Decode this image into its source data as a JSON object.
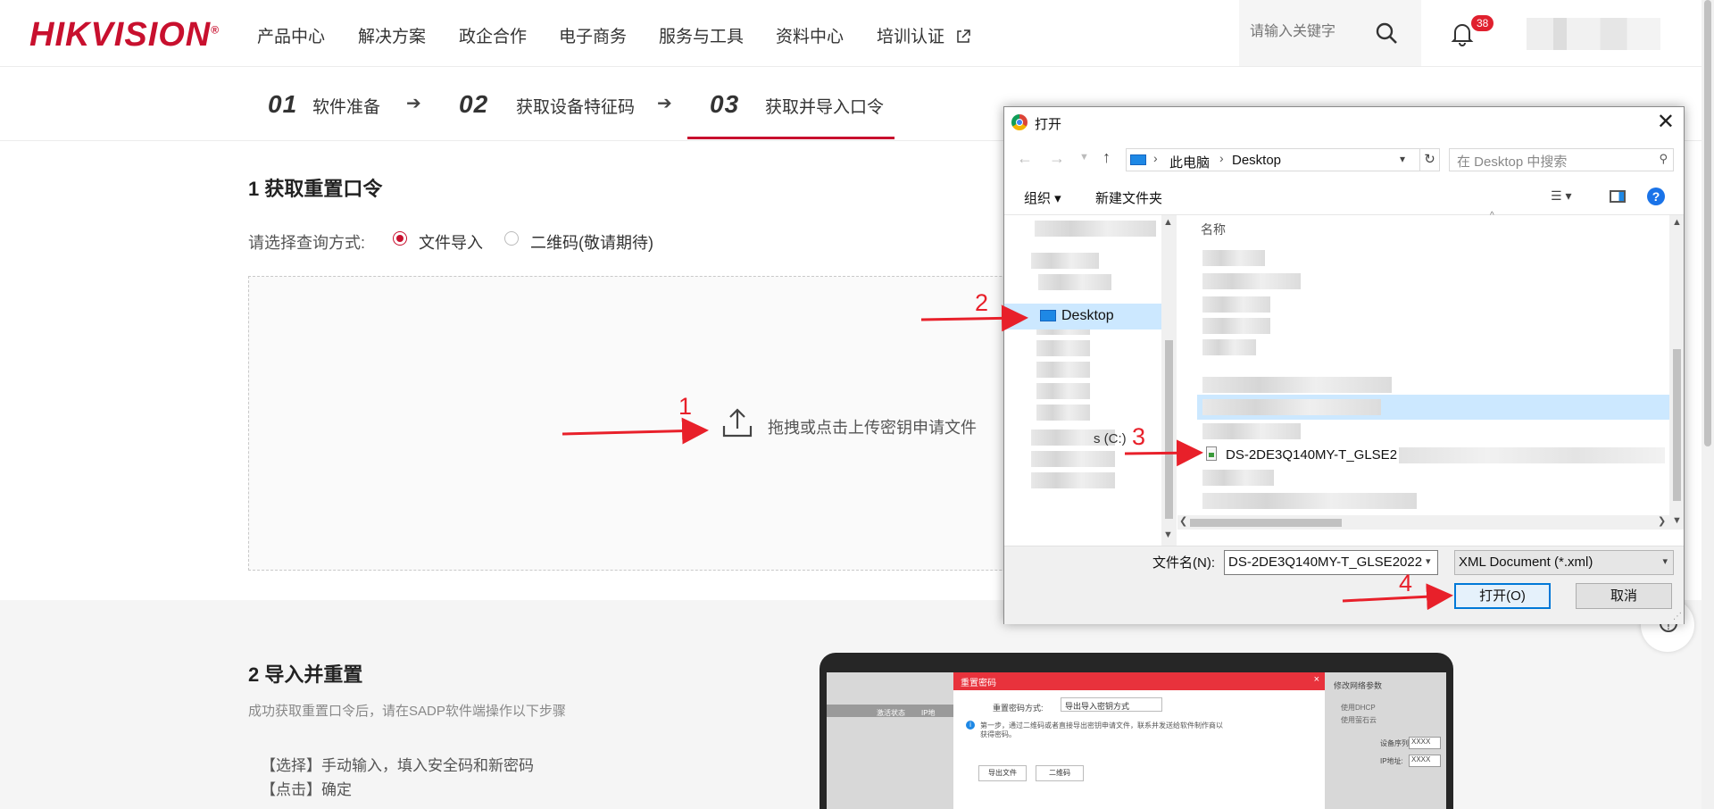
{
  "header": {
    "logo": "HIKVISION",
    "logo_mark": "®",
    "nav": [
      "产品中心",
      "解决方案",
      "政企合作",
      "电子商务",
      "服务与工具",
      "资料中心",
      "培训认证"
    ],
    "search_placeholder": "请输入关键字",
    "notification_count": "38"
  },
  "steps": [
    {
      "num": "01",
      "label": "软件准备"
    },
    {
      "num": "02",
      "label": "获取设备特征码"
    },
    {
      "num": "03",
      "label": "获取并导入口令"
    }
  ],
  "section1": {
    "title": "1 获取重置口令",
    "query_label": "请选择查询方式:",
    "options": [
      "文件导入",
      "二维码(敬请期待)"
    ],
    "selected_option": "文件导入",
    "dropzone_text": "拖拽或点击上传密钥申请文件"
  },
  "section2": {
    "title": "2 导入并重置",
    "subtitle": "成功获取重置口令后，请在SADP软件端操作以下步骤",
    "steps": [
      "【选择】手动输入，填入安全码和新密码",
      "【点击】确定"
    ],
    "preview": {
      "dialog_title": "重置密码",
      "method_label": "重置密码方式:",
      "method_value": "导出导入密钥方式",
      "desc_line1": "第一步，通过二维码或者直接导出密钥申请文件，联系并发送给软件制作商以",
      "desc_line2": "获得密码。",
      "btn_export": "导出文件",
      "btn_qr": "二维码",
      "table_col1": "激活状态",
      "table_col2": "IP地",
      "side_title": "修改网络参数",
      "side_dhcp": "使用DHCP",
      "side_hik": "使用萤石云",
      "side_serial": "设备序列号:",
      "side_ip": "IP地址:",
      "side_value": "XXXX"
    }
  },
  "dialog": {
    "title": "打开",
    "breadcrumb": [
      "此电脑",
      "Desktop"
    ],
    "search_placeholder": "在 Desktop 中搜索",
    "toolbar": {
      "organize": "组织 ▾",
      "new_folder": "新建文件夹"
    },
    "left_pane_selected": "Desktop",
    "left_pane_drive": "s (C:)",
    "column_name": "名称",
    "file_name_visible": "DS-2DE3Q140MY-T_GLSE2",
    "filename_label": "文件名(N):",
    "filename_value": "DS-2DE3Q140MY-T_GLSE2022",
    "filetype_value": "XML Document (*.xml)",
    "open_button": "打开(O)",
    "cancel_button": "取消"
  },
  "annotations": [
    "1",
    "2",
    "3",
    "4"
  ],
  "colors": {
    "brand_red": "#c8102e",
    "annotation_red": "#e8202a",
    "selection_blue": "#cce8ff",
    "badge": "#e0202e"
  }
}
